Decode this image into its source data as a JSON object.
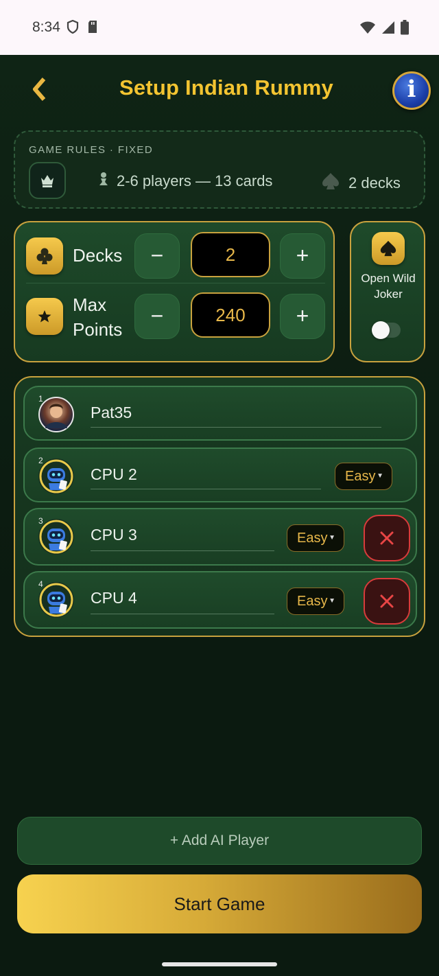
{
  "status_bar": {
    "time": "8:34"
  },
  "header": {
    "title": "Setup Indian Rummy"
  },
  "rules": {
    "header": "GAME RULES · FIXED",
    "players_text": "2-6 players — 13 cards",
    "decks_text": "2 decks"
  },
  "settings": {
    "decks_label": "Decks",
    "decks_value": "2",
    "max_points_label": "Max Points",
    "max_points_value": "240",
    "minus_label": "−",
    "plus_label": "+",
    "open_wild_joker_label": "Open Wild Joker",
    "open_wild_joker_enabled": false
  },
  "players": [
    {
      "number": "1",
      "name": "Pat35",
      "type": "human"
    },
    {
      "number": "2",
      "name": "CPU 2",
      "type": "cpu",
      "difficulty": "Easy",
      "removable": false
    },
    {
      "number": "3",
      "name": "CPU 3",
      "type": "cpu",
      "difficulty": "Easy",
      "removable": true
    },
    {
      "number": "4",
      "name": "CPU 4",
      "type": "cpu",
      "difficulty": "Easy",
      "removable": true
    }
  ],
  "actions": {
    "add_ai_player": "+ Add AI Player",
    "start_game": "Start Game"
  },
  "colors": {
    "gold": "#c9a23e",
    "title_gold": "#f3c431",
    "background": "#0c1c11",
    "remove_red": "#d93b3b"
  }
}
